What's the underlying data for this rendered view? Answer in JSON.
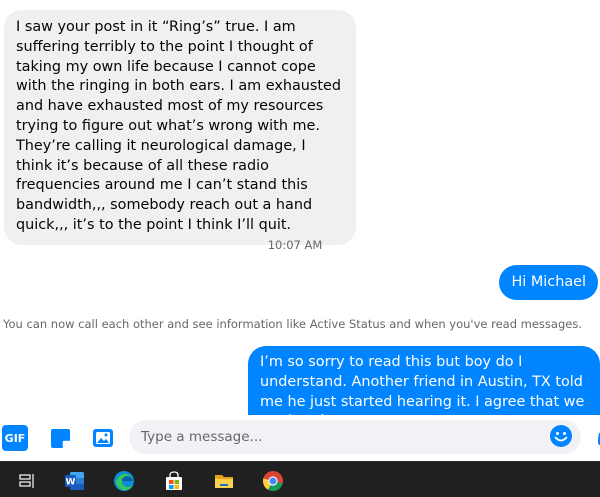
{
  "messages": {
    "incoming_text": "I saw your post in it “Ring’s” true. I am suffering terribly to the point I thought of taking my own life because I cannot cope with the ringing in both ears. I am exhausted and have exhausted most of my resources trying to figure out what’s wrong with me. They’re calling it neurological damage, I think it’s because of all these radio frequencies around me I can’t stand this bandwidth,,, somebody reach out a hand quick,,, it’s to the point I think I’ll quit.",
    "timestamp": "10:07 AM",
    "outgoing_greeting": "Hi Michael",
    "notice": "You can now call each other and see information like Active Status and when you've read messages.",
    "outgoing_reply": "I’m so sorry to read this but boy do I understand. Another friend in Austin, TX told me he just started hearing it.  I agree that we are hearing"
  },
  "composer": {
    "gif_label": "GIF",
    "placeholder": "Type a message..."
  },
  "taskbar": {
    "icons": [
      "task-view-icon",
      "word-icon",
      "edge-icon",
      "store-icon",
      "file-explorer-icon",
      "chrome-icon"
    ]
  },
  "colors": {
    "outgoing_bubble": "#0084ff",
    "incoming_bubble": "#f0f0f0",
    "meta_text": "#65676b",
    "taskbar": "#202020"
  }
}
